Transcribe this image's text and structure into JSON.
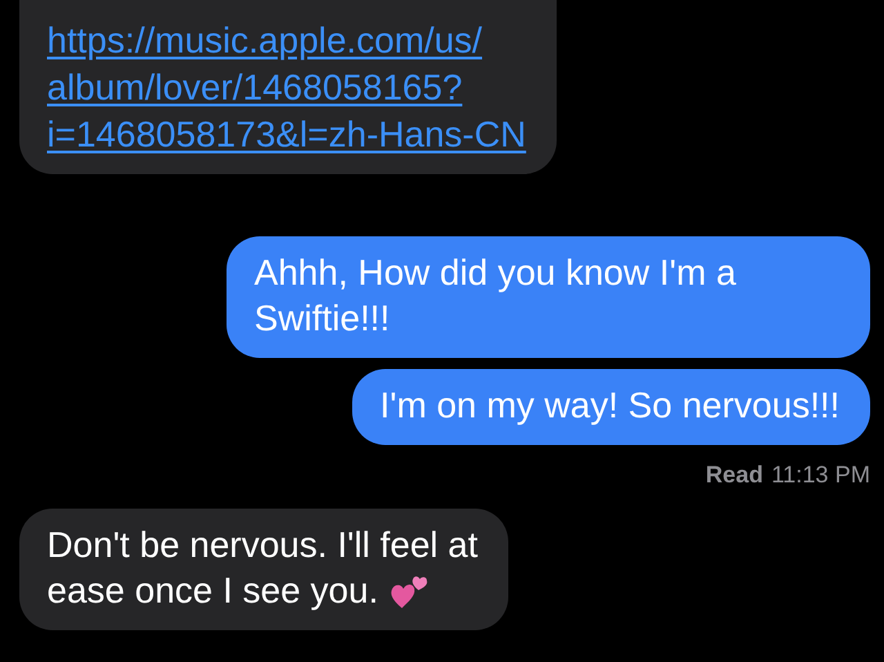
{
  "messages": [
    {
      "kind": "received",
      "link_lines": [
        "https://music.apple.com/us/",
        "album/lover/1468058165?",
        "i=1468058173&l=zh-Hans-CN"
      ]
    },
    {
      "kind": "sent",
      "text": "Ahhh, How did you know I'm a Swiftie!!!"
    },
    {
      "kind": "sent",
      "text": "I'm on my way! So nervous!!!"
    },
    {
      "kind": "receipt",
      "label": "Read",
      "time": "11:13 PM"
    },
    {
      "kind": "received",
      "text_lines": [
        "Don't be nervous. I'll feel at",
        "ease once I see you."
      ],
      "hearts": true
    }
  ]
}
